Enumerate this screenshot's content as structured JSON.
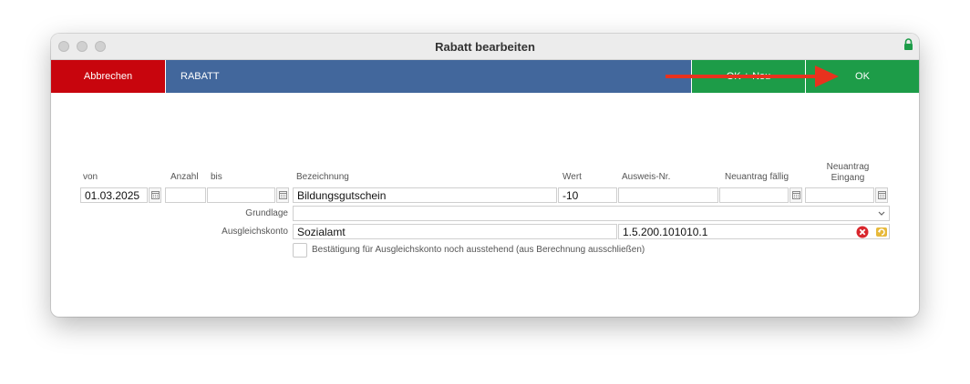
{
  "window": {
    "title": "Rabatt bearbeiten"
  },
  "toolbar": {
    "cancel_label": "Abbrechen",
    "section_title": "RABATT",
    "ok_new_label": "OK + Neu",
    "ok_label": "OK"
  },
  "colors": {
    "cancel": "#c8050d",
    "section": "#42679c",
    "ok": "#1d9c48",
    "arrow": "#e8321e"
  },
  "labels": {
    "von": "von",
    "anzahl": "Anzahl",
    "bis": "bis",
    "bezeichnung": "Bezeichnung",
    "wert": "Wert",
    "ausweis_nr": "Ausweis-Nr.",
    "neuantrag_faellig": "Neuantrag fällig",
    "neuantrag_eingang_1": "Neuantrag",
    "neuantrag_eingang_2": "Eingang",
    "grundlage": "Grundlage",
    "ausgleichskonto": "Ausgleichskonto"
  },
  "fields": {
    "von": "01.03.2025",
    "anzahl": "",
    "bis": "",
    "bezeichnung": "Bildungsgutschein",
    "wert": "-10",
    "ausweis_nr": "",
    "neuantrag_faellig": "",
    "neuantrag_eingang": "",
    "grundlage": "",
    "ausgleichskonto_name": "Sozialamt",
    "ausgleichskonto_nr": "1.5.200.101010.1"
  },
  "checkbox": {
    "checked": false,
    "label": "Bestätigung für Ausgleichskonto noch ausstehend (aus Berechnung ausschließen)"
  },
  "icons": {
    "lock": "lock-icon",
    "calendar": "calendar-icon",
    "chevron": "chevron-down-icon",
    "clear": "clear-icon",
    "lookup": "lookup-icon"
  }
}
